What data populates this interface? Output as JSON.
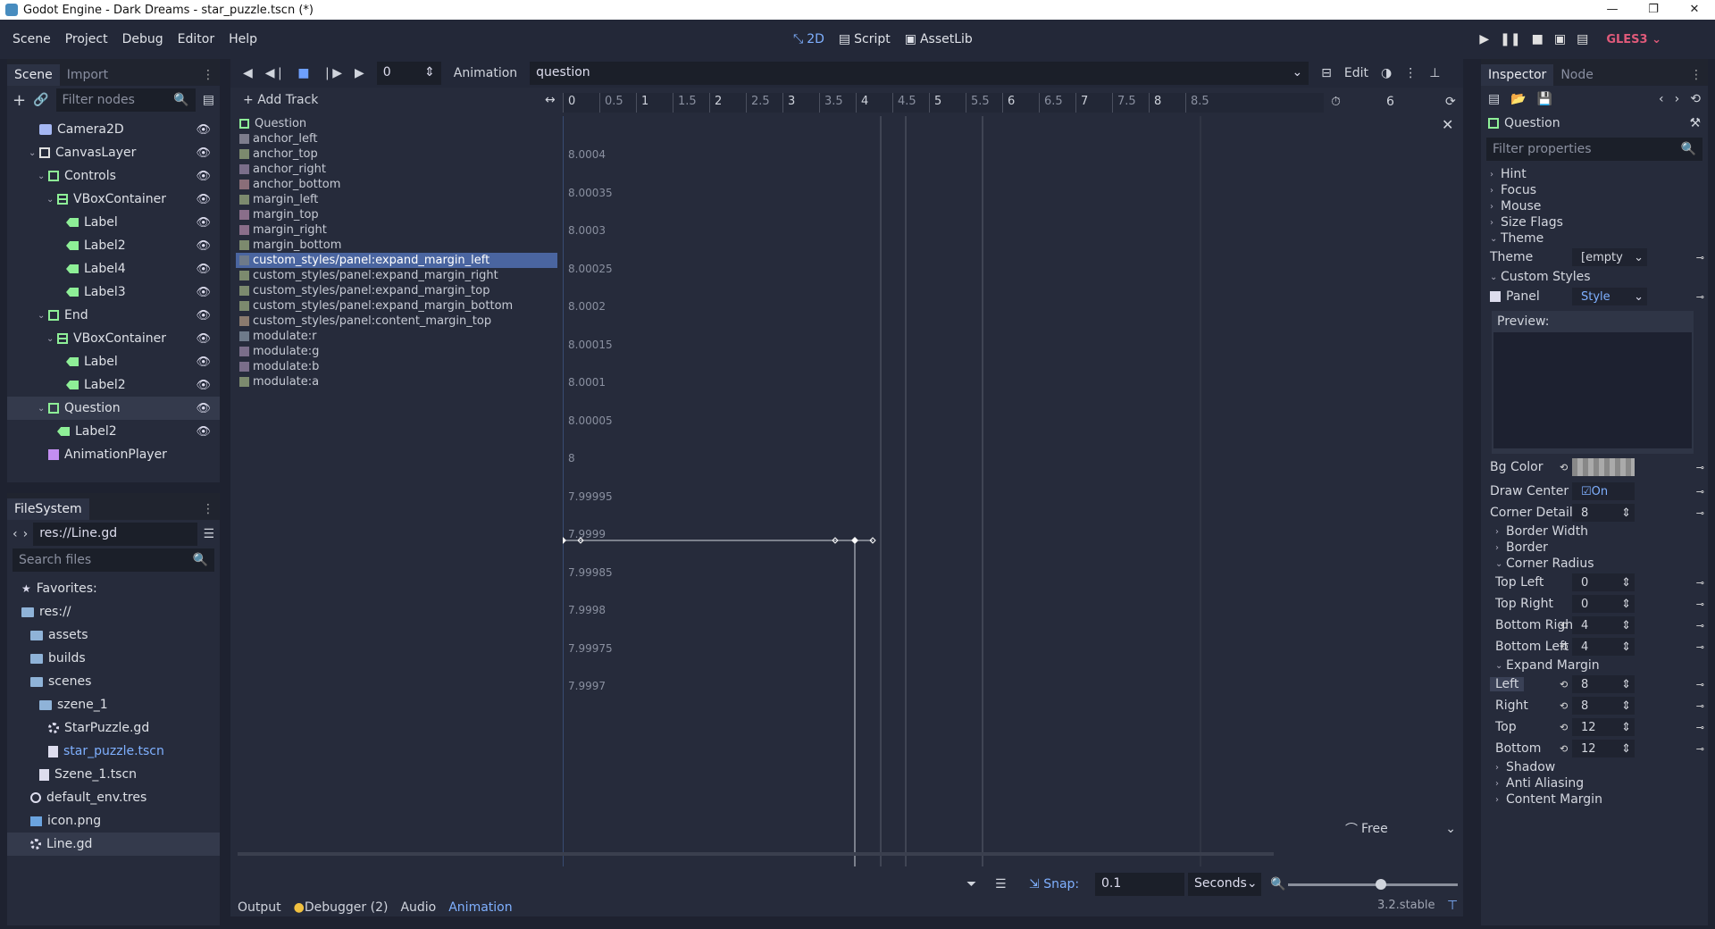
{
  "window": {
    "title": "Godot Engine - Dark Dreams - star_puzzle.tscn (*)",
    "controls": [
      "—",
      "❐",
      "✕"
    ]
  },
  "menubar": {
    "items": [
      "Scene",
      "Project",
      "Debug",
      "Editor",
      "Help"
    ],
    "workspaces": [
      "2D",
      "Script",
      "AssetLib"
    ],
    "renderer": "GLES3"
  },
  "scene_dock": {
    "tabs": [
      "Scene",
      "Import"
    ],
    "filter_placeholder": "Filter nodes",
    "nodes": [
      {
        "label": "Camera2D",
        "icon": "camera-icon",
        "depth": 1
      },
      {
        "label": "CanvasLayer",
        "icon": "canvas-icon",
        "depth": 1
      },
      {
        "label": "Controls",
        "icon": "control-icon",
        "depth": 2
      },
      {
        "label": "VBoxContainer",
        "icon": "vbox-icon",
        "depth": 3
      },
      {
        "label": "Label",
        "icon": "label-icon",
        "depth": 4
      },
      {
        "label": "Label2",
        "icon": "label-icon",
        "depth": 4
      },
      {
        "label": "Label4",
        "icon": "label-icon",
        "depth": 4
      },
      {
        "label": "Label3",
        "icon": "label-icon",
        "depth": 4
      },
      {
        "label": "End",
        "icon": "control-icon",
        "depth": 2
      },
      {
        "label": "VBoxContainer",
        "icon": "vbox-icon",
        "depth": 3
      },
      {
        "label": "Label",
        "icon": "label-icon",
        "depth": 4
      },
      {
        "label": "Label2",
        "icon": "label-icon",
        "depth": 4
      },
      {
        "label": "Question",
        "icon": "control-icon",
        "depth": 2
      },
      {
        "label": "Label2",
        "icon": "label-icon",
        "depth": 3
      },
      {
        "label": "AnimationPlayer",
        "icon": "animation-player-icon",
        "depth": 2
      }
    ]
  },
  "filesystem": {
    "title": "FileSystem",
    "path": "res://Line.gd",
    "search_placeholder": "Search files",
    "items": [
      {
        "label": "Favorites:",
        "icon": "star-icon",
        "depth": 0
      },
      {
        "label": "res://",
        "icon": "folder-icon",
        "depth": 0
      },
      {
        "label": "assets",
        "icon": "folder-icon",
        "depth": 1
      },
      {
        "label": "builds",
        "icon": "folder-icon",
        "depth": 1
      },
      {
        "label": "scenes",
        "icon": "folder-icon",
        "depth": 1
      },
      {
        "label": "szene_1",
        "icon": "folder-icon",
        "depth": 2
      },
      {
        "label": "StarPuzzle.gd",
        "icon": "gear-icon",
        "depth": 3
      },
      {
        "label": "star_puzzle.tscn",
        "icon": "scene-file-icon",
        "depth": 3
      },
      {
        "label": "Szene_1.tscn",
        "icon": "scene-file-icon",
        "depth": 2
      },
      {
        "label": "default_env.tres",
        "icon": "globe-icon",
        "depth": 1
      },
      {
        "label": "icon.png",
        "icon": "image-icon",
        "depth": 1
      },
      {
        "label": "Line.gd",
        "icon": "gear-icon",
        "depth": 1
      }
    ]
  },
  "animation": {
    "time": "0",
    "label": "Animation",
    "current": "question",
    "edit_label": "Edit",
    "add_track": "Add Track",
    "ruler": [
      "0",
      "0.5",
      "1",
      "1.5",
      "2",
      "2.5",
      "3",
      "3.5",
      "4",
      "4.5",
      "5",
      "5.5",
      "6",
      "6.5",
      "7",
      "7.5",
      "8",
      "8.5"
    ],
    "length": "6",
    "root_track": "Question",
    "tracks": [
      {
        "name": "anchor_left",
        "color": "#7d7d8c"
      },
      {
        "name": "anchor_top",
        "color": "#7c8a6e"
      },
      {
        "name": "anchor_right",
        "color": "#7a6e8a"
      },
      {
        "name": "anchor_bottom",
        "color": "#8a6e78"
      },
      {
        "name": "margin_left",
        "color": "#7c8a6e"
      },
      {
        "name": "margin_top",
        "color": "#8a6e8a"
      },
      {
        "name": "margin_right",
        "color": "#8a6e8a"
      },
      {
        "name": "margin_bottom",
        "color": "#7c8a6e"
      },
      {
        "name": "custom_styles/panel:expand_margin_left",
        "color": "#6e7a8a"
      },
      {
        "name": "custom_styles/panel:expand_margin_right",
        "color": "#7c8a6e"
      },
      {
        "name": "custom_styles/panel:expand_margin_top",
        "color": "#7c8a6e"
      },
      {
        "name": "custom_styles/panel:expand_margin_bottom",
        "color": "#7c8a6e"
      },
      {
        "name": "custom_styles/panel:content_margin_top",
        "color": "#8a7a6e"
      },
      {
        "name": "modulate:r",
        "color": "#6e7a8a"
      },
      {
        "name": "modulate:g",
        "color": "#7a6e8a"
      },
      {
        "name": "modulate:b",
        "color": "#7a6e8a"
      },
      {
        "name": "modulate:a",
        "color": "#7c8a6e"
      }
    ],
    "y_labels": [
      "8.0004",
      "8.00035",
      "8.0003",
      "8.00025",
      "8.0002",
      "8.00015",
      "8.0001",
      "8.00005",
      "8",
      "7.99995",
      "7.9999",
      "7.99985",
      "7.9998",
      "7.99975",
      "7.9997"
    ],
    "interp": "Free",
    "snap_label": "Snap:",
    "snap_value": "0.1",
    "unit": "Seconds"
  },
  "bottom_panel": {
    "tabs": [
      "Output",
      "Debugger (2)",
      "Audio",
      "Animation"
    ],
    "version": "3.2.stable"
  },
  "inspector": {
    "tabs": [
      "Inspector",
      "Node"
    ],
    "object": "Question",
    "filter_placeholder": "Filter properties",
    "sections_top": [
      "Hint",
      "Focus",
      "Mouse",
      "Size Flags",
      "Theme"
    ],
    "theme_label": "Theme",
    "theme_value": "[empty",
    "custom_styles": "Custom Styles",
    "panel_label": "Panel",
    "panel_value": "Style",
    "preview": "Preview:",
    "bg_color": "Bg Color",
    "draw_center": "Draw Center",
    "draw_center_value": "On",
    "corner_detail": "Corner Detail",
    "corner_detail_value": "8",
    "border_width": "Border Width",
    "border": "Border",
    "corner_radius": "Corner Radius",
    "corner_rows": [
      {
        "label": "Top Left",
        "value": "0"
      },
      {
        "label": "Top Right",
        "value": "0"
      },
      {
        "label": "Bottom Righ",
        "value": "4"
      },
      {
        "label": "Bottom Left",
        "value": "4"
      }
    ],
    "expand_margin": "Expand Margin",
    "expand_rows": [
      {
        "label": "Left",
        "value": "8"
      },
      {
        "label": "Right",
        "value": "8"
      },
      {
        "label": "Top",
        "value": "12"
      },
      {
        "label": "Bottom",
        "value": "12"
      }
    ],
    "sections_bottom": [
      "Shadow",
      "Anti Aliasing",
      "Content Margin"
    ]
  }
}
